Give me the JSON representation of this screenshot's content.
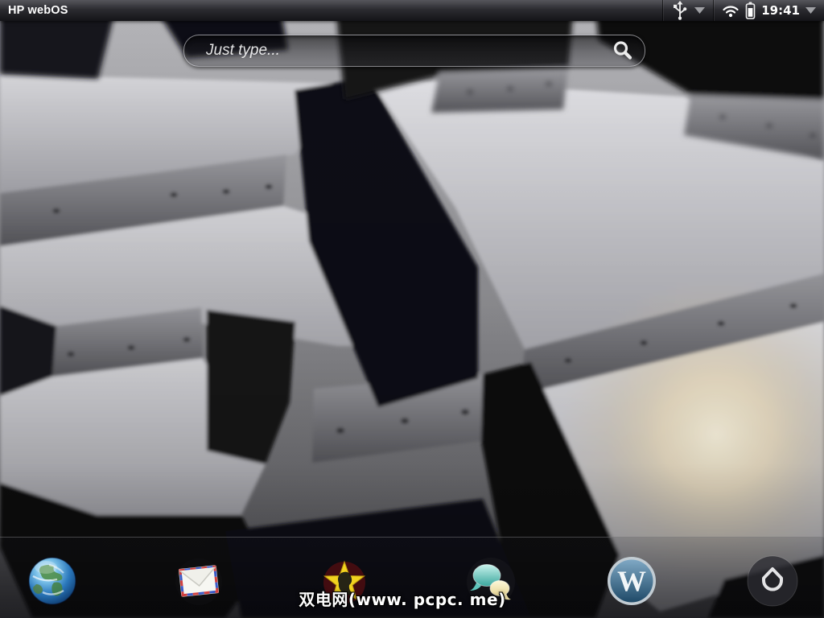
{
  "status_bar": {
    "title": "HP webOS",
    "time": "19:41",
    "icons": {
      "usb": "usb-icon",
      "usb_menu": "dropdown-arrow-icon",
      "wifi": "wifi-icon",
      "battery": "battery-icon",
      "system_menu": "dropdown-arrow-icon"
    }
  },
  "search_bar": {
    "placeholder": "Just type...",
    "icon": "search-icon"
  },
  "dock": {
    "items": [
      {
        "icon": "globe-icon"
      },
      {
        "icon": "envelope-icon"
      },
      {
        "icon": "star-icon"
      },
      {
        "icon": "chat-bubbles-icon"
      },
      {
        "icon": "wordpress-icon"
      },
      {
        "icon": "launcher-up-arrow-icon"
      }
    ]
  },
  "watermark": {
    "text": "双电网(www. pcpc. me)"
  },
  "colors": {
    "status_bar_bg": "#1c1c20",
    "search_pill_border": "#d9d9dc",
    "glow_highlight": "#f4e6c4",
    "wordpress_blue": "#2d5b7d",
    "chat_teal": "#52c2b8",
    "chat_cream": "#f3e9b9",
    "star_yellow": "#f2d21f"
  }
}
